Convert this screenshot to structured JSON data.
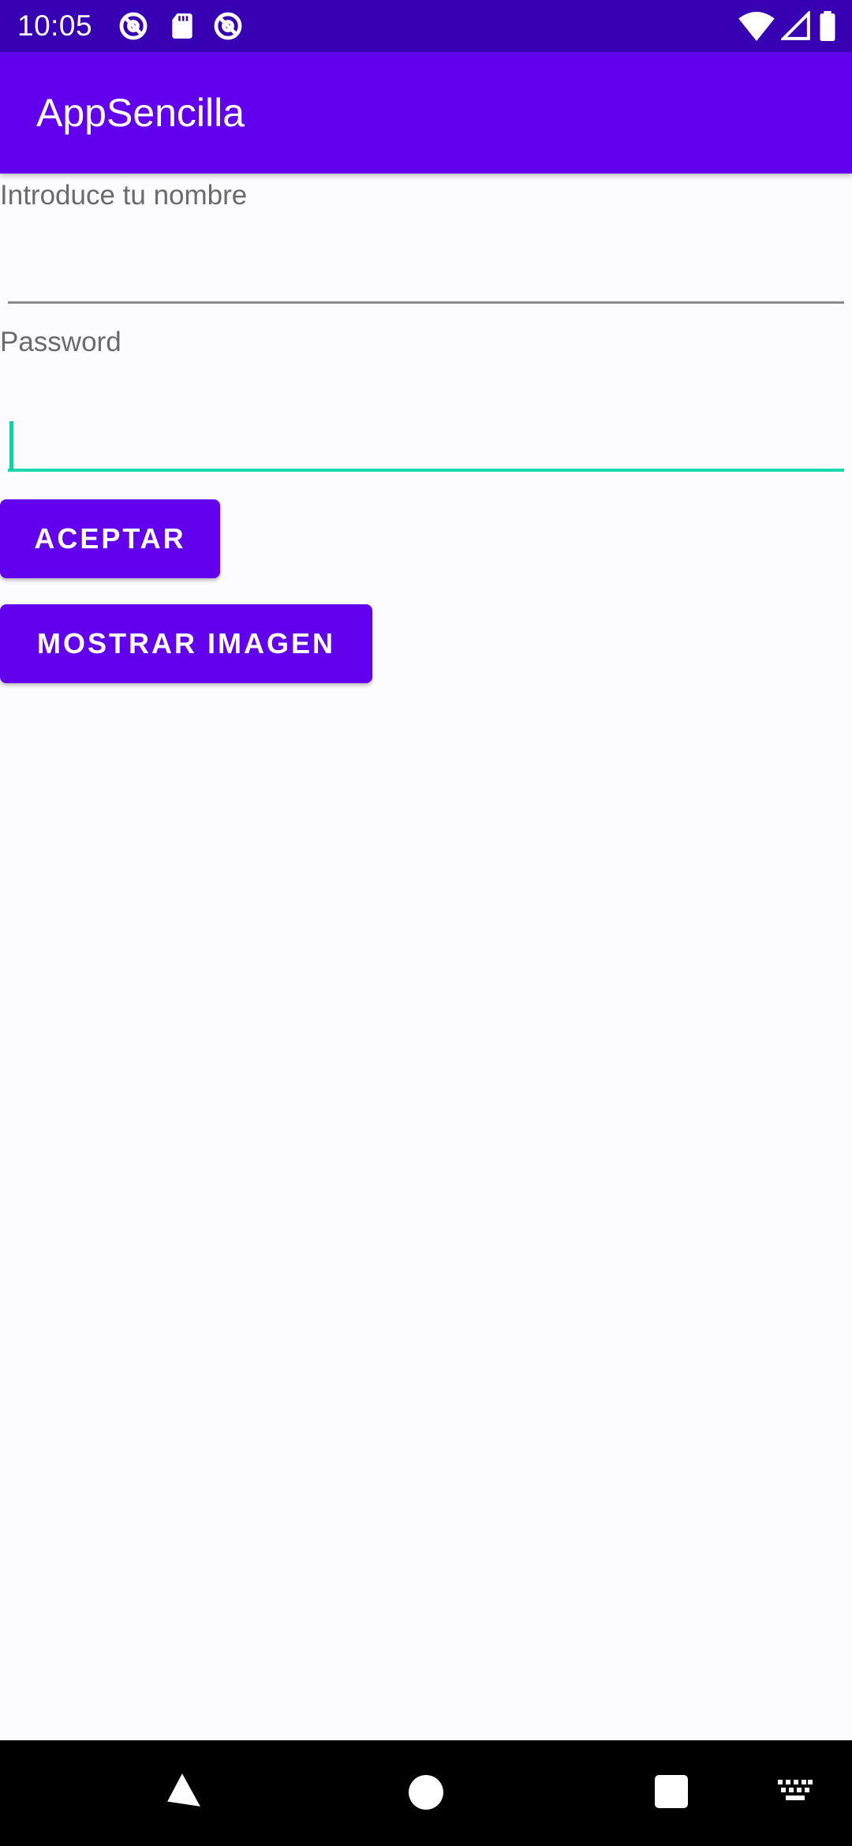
{
  "status_bar": {
    "time": "10:05",
    "left_icons": [
      "at-sign-icon",
      "sd-card-icon",
      "at-sign-icon"
    ],
    "right_icons": [
      "wifi-icon",
      "cell-signal-icon",
      "battery-icon"
    ]
  },
  "app_bar": {
    "title": "AppSencilla",
    "color": "#6200ee"
  },
  "form": {
    "name_label": "Introduce tu nombre",
    "name_value": "",
    "password_label": "Password",
    "password_value": "",
    "accept_label": "ACEPTAR",
    "show_image_label": "MOSTRAR IMAGEN",
    "focus_color": "#1dd9b0"
  },
  "nav_bar": {
    "icons": [
      "back-icon",
      "home-icon",
      "recents-icon",
      "keyboard-icon"
    ]
  }
}
